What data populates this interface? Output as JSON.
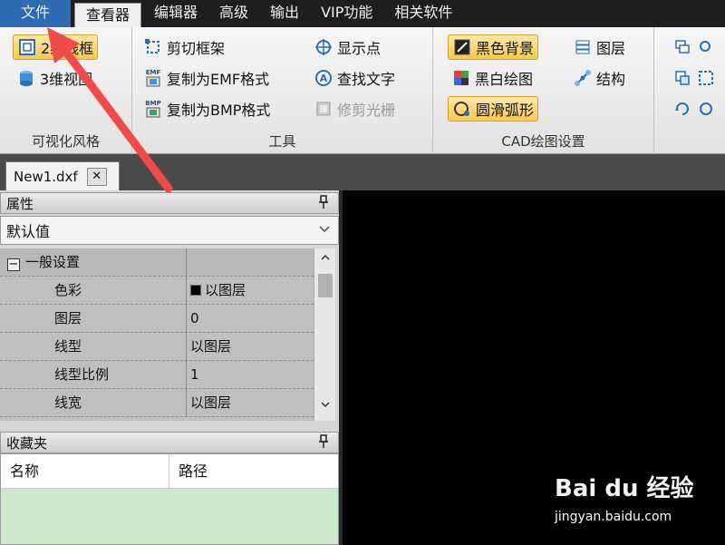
{
  "menubar": {
    "items": [
      "文件",
      "查看器",
      "编辑器",
      "高级",
      "输出",
      "VIP功能",
      "相关软件"
    ]
  },
  "ribbon": {
    "group1": {
      "label": "可视化风格",
      "btn_2d": "2维线框",
      "btn_3d": "3维视图"
    },
    "group2": {
      "label": "工具",
      "clip_frame": "剪切框架",
      "copy_emf": "复制为EMF格式",
      "copy_bmp": "复制为BMP格式",
      "show_points": "显示点",
      "find_text": "查找文字",
      "trim_raster": "修剪光栅",
      "emf_tag": "EMF",
      "bmp_tag": "BMP"
    },
    "group3": {
      "label": "CAD绘图设置",
      "black_bg": "黑色背景",
      "bw_draw": "黑白绘图",
      "smooth_arc": "圆滑弧形",
      "layers": "图层",
      "structure": "结构"
    }
  },
  "doc_tab": {
    "name": "New1.dxf",
    "close": "✕"
  },
  "properties": {
    "title": "属性",
    "pin": "ꟷ",
    "combo_value": "默认值",
    "category": "一般设置",
    "expander": "−",
    "rows": [
      {
        "key": "色彩",
        "value": "以图层"
      },
      {
        "key": "图层",
        "value": "0"
      },
      {
        "key": "线型",
        "value": "以图层"
      },
      {
        "key": "线型比例",
        "value": "1"
      },
      {
        "key": "线宽",
        "value": "以图层"
      }
    ]
  },
  "favorites": {
    "title": "收藏夹",
    "col_name": "名称",
    "col_path": "路径"
  },
  "watermark": {
    "logo": "Bai du 经验",
    "url": "jingyan.baidu.com"
  },
  "colors": {
    "file_menu": "#2d6bb3",
    "highlight": "#f7c94e",
    "arrow": "#f04a4a",
    "canvas": "#000000",
    "favorites_bg": "#cbe8cb"
  }
}
